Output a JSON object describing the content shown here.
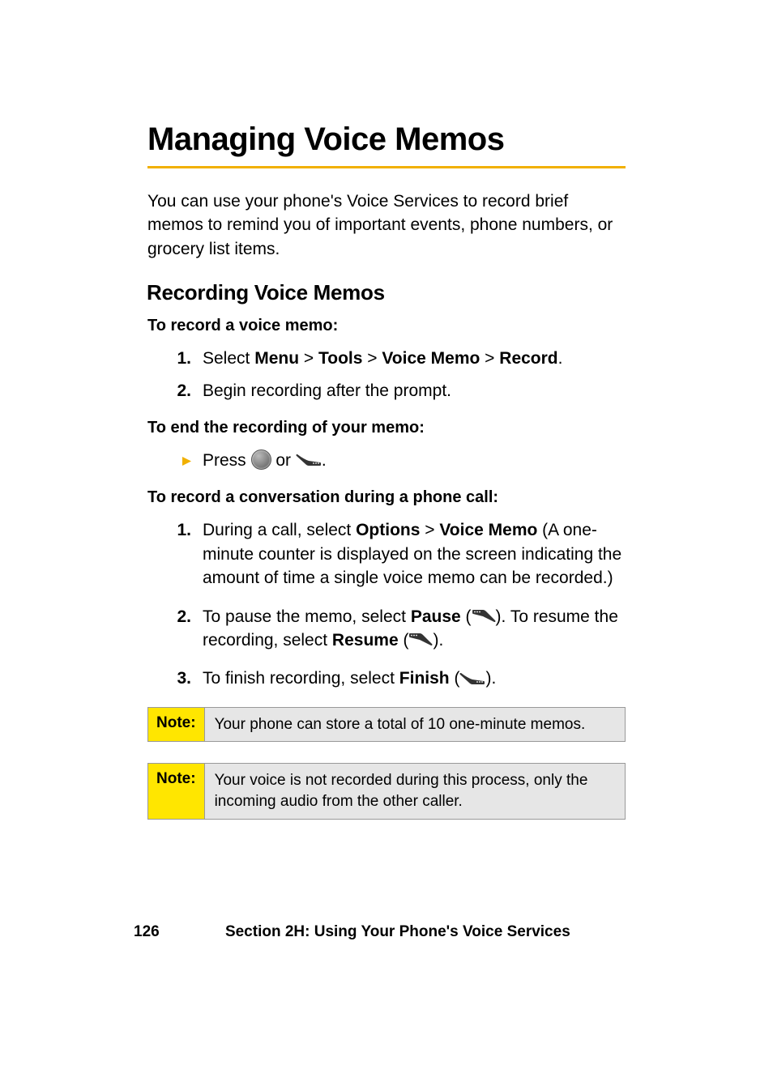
{
  "title": "Managing Voice Memos",
  "intro": "You can use your phone's Voice Services to record brief memos to remind you of important events, phone numbers, or grocery list items.",
  "subheading": "Recording Voice Memos",
  "lead1": "To record a voice memo:",
  "steps1": {
    "n1": "1.",
    "t1_pre": "Select ",
    "menu": "Menu",
    "sep": " > ",
    "tools": "Tools",
    "voicememo": "Voice Memo",
    "record": "Record",
    "period": ".",
    "n2": "2.",
    "t2": "Begin recording after the prompt."
  },
  "lead2": "To end the recording of your memo:",
  "bullet": {
    "pre": "Press ",
    "or": " or ",
    "post": "."
  },
  "lead3": "To record a conversation during a phone call:",
  "steps2": {
    "n1": "1.",
    "t1_pre": "During a call, select ",
    "options": "Options",
    "sep": " > ",
    "voicememo": "Voice Memo",
    "t1_post": " (A one-minute counter is displayed on the screen indicating the amount of time a single voice memo can be recorded.)",
    "n2": "2.",
    "t2_pre": "To pause the memo, select ",
    "pause": "Pause",
    "paren_open": " (",
    "paren_close_dot": "). ",
    "t2_mid": "To resume the recording, select ",
    "resume": "Resume",
    "paren_close_dot2": ").",
    "n3": "3.",
    "t3_pre": "To finish recording, select ",
    "finish": "Finish",
    "paren_close_dot3": ")."
  },
  "note_label": "Note:",
  "note1": "Your phone can store a total of  10 one-minute memos.",
  "note2": "Your voice is not recorded during this process, only the incoming audio from the other caller.",
  "footer": {
    "page": "126",
    "section": "Section 2H: Using Your Phone's Voice Services"
  }
}
